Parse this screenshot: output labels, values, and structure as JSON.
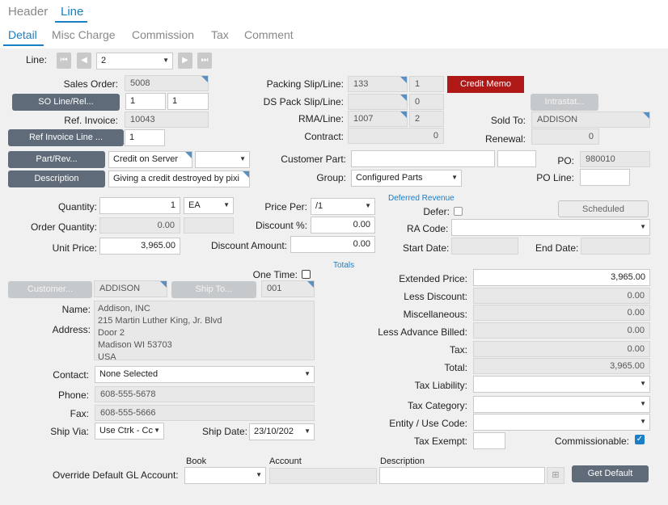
{
  "tabs_top": [
    "Header",
    "Line"
  ],
  "tabs_sub": [
    "Detail",
    "Misc Charge",
    "Commission",
    "Tax",
    "Comment"
  ],
  "line": {
    "label": "Line:",
    "value": "2"
  },
  "labels": {
    "sales_order": "Sales Order:",
    "ref_invoice": "Ref. Invoice:",
    "packing_slip": "Packing Slip/Line:",
    "ds_pack": "DS Pack Slip/Line:",
    "rma": "RMA/Line:",
    "contract": "Contract:",
    "sold_to": "Sold To:",
    "renewal": "Renewal:",
    "customer_part": "Customer Part:",
    "group": "Group:",
    "po": "PO:",
    "po_line": "PO Line:",
    "quantity": "Quantity:",
    "order_qty": "Order Quantity:",
    "unit_price": "Unit Price:",
    "price_per": "Price Per:",
    "discount_pct": "Discount %:",
    "discount_amt": "Discount Amount:",
    "deferred_revenue": "Deferred Revenue",
    "defer": "Defer:",
    "ra_code": "RA Code:",
    "start_date": "Start Date:",
    "end_date": "End Date:",
    "totals": "Totals",
    "one_time": "One Time:",
    "name": "Name:",
    "address": "Address:",
    "contact": "Contact:",
    "phone": "Phone:",
    "fax": "Fax:",
    "ship_via": "Ship Via:",
    "ship_date": "Ship Date:",
    "extended_price": "Extended Price:",
    "less_discount": "Less Discount:",
    "misc": "Miscellaneous:",
    "less_adv": "Less Advance Billed:",
    "tax": "Tax:",
    "total": "Total:",
    "tax_liability": "Tax Liability:",
    "tax_category": "Tax Category:",
    "entity_use": "Entity / Use Code:",
    "tax_exempt": "Tax Exempt:",
    "commissionable": "Commissionable:",
    "book": "Book",
    "account": "Account",
    "description_col": "Description",
    "override_gl": "Override Default GL Account:"
  },
  "buttons": {
    "so_line_rel": "SO Line/Rel...",
    "ref_invoice_line": "Ref Invoice Line ...",
    "part_rev": "Part/Rev...",
    "description": "Description",
    "credit_memo": "Credit Memo",
    "intrastat": "Intrastat...",
    "scheduled": "Scheduled",
    "customer": "Customer...",
    "ship_to": "Ship To...",
    "get_default": "Get Default"
  },
  "values": {
    "sales_order": "5008",
    "so_line": "1",
    "so_rel": "1",
    "ref_invoice": "10043",
    "ref_invoice_line": "1",
    "part": "Credit on Server",
    "part_rev": "",
    "description": "Giving a credit destroyed by pixi",
    "packing_slip": "133",
    "packing_line": "1",
    "ds_pack_slip": "",
    "ds_pack_line": "0",
    "rma": "1007",
    "rma_line": "2",
    "contract": "0",
    "sold_to": "ADDISON",
    "renewal": "0",
    "customer_part": "",
    "customer_part_rev": "",
    "group": "Configured Parts",
    "po": "980010",
    "po_line": "",
    "quantity": "1",
    "uom": "EA",
    "order_qty": "0.00",
    "unit_price": "3,965.00",
    "price_per": "/1",
    "discount_pct": "0.00",
    "discount_amt": "0.00",
    "customer": "ADDISON",
    "ship_to": "001",
    "name": "Addison, INC",
    "address_lines": [
      "215 Martin Luther King, Jr. Blvd",
      "Door 2",
      "Madison WI 53703",
      "USA"
    ],
    "contact": "None Selected",
    "phone": "608-555-5678",
    "fax": "608-555-5666",
    "ship_via": "Use Ctrk - Cc",
    "ship_date": "23/10/202",
    "extended_price": "3,965.00",
    "less_discount": "0.00",
    "misc": "0.00",
    "less_adv": "0.00",
    "tax": "0.00",
    "total": "3,965.00"
  },
  "states": {
    "defer": false,
    "one_time": false,
    "commissionable": true
  },
  "colors": {
    "accent": "#1a7fc4",
    "button": "#5f6b78",
    "credit_memo": "#b01717"
  }
}
